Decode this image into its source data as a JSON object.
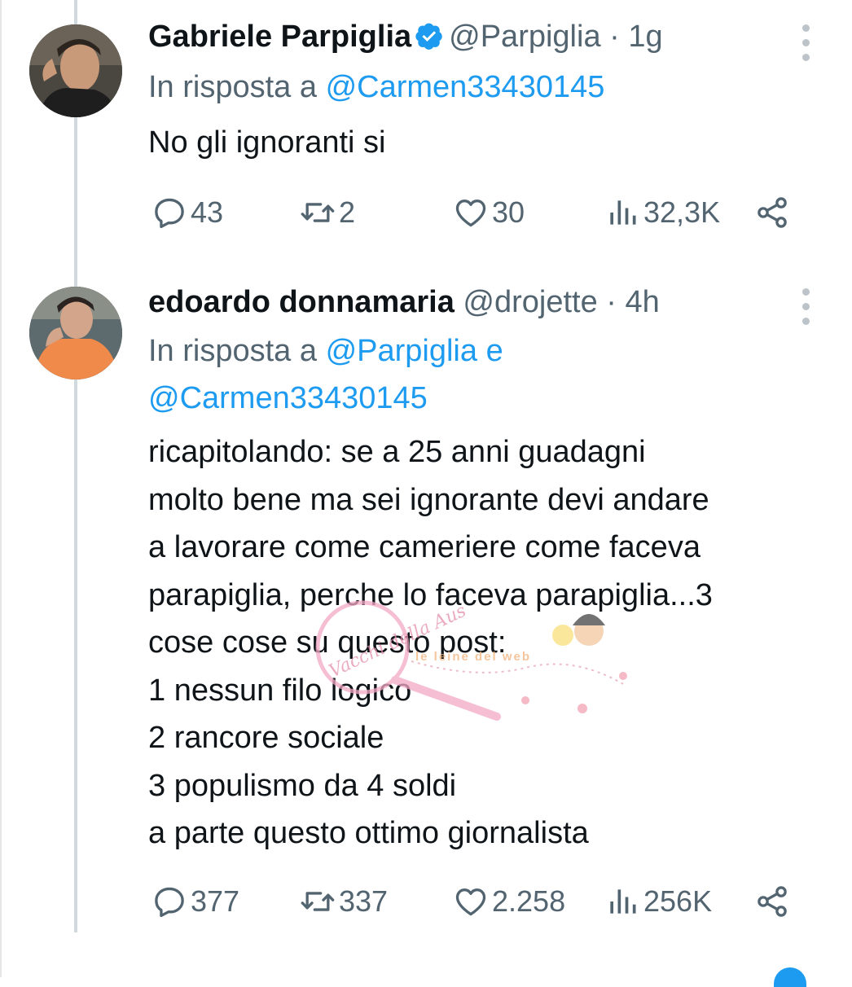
{
  "tweets": [
    {
      "name": "Gabriele Parpiglia",
      "verified": true,
      "handle": "@Parpiglia",
      "separator": "·",
      "time": "1g",
      "reply_prefix": "In risposta a",
      "reply_to_1": "@Carmen33430145",
      "reply_joiner": "",
      "reply_to_2": "",
      "text_lines": [
        "No gli ignoranti si"
      ],
      "replies": "43",
      "retweets": "2",
      "likes": "30",
      "views": "32,3K"
    },
    {
      "name": "edoardo donnamaria",
      "verified": false,
      "handle": "@drojette",
      "separator": "·",
      "time": "4h",
      "reply_prefix": "In risposta a",
      "reply_to_1": "@Parpiglia",
      "reply_joiner": "e",
      "reply_to_2": "@Carmen33430145",
      "text_lines": [
        "ricapitolando: se a 25 anni guadagni",
        "molto bene ma sei ignorante devi andare",
        "a lavorare come cameriere come faceva",
        "parapiglia, perche lo faceva parapiglia...3",
        "cose cose su questo post:",
        "1 nessun filo logico",
        "2 rancore sociale",
        "3 populismo da 4 soldi",
        "a parte questo ottimo giornalista"
      ],
      "replies": "377",
      "retweets": "337",
      "likes": "2.258",
      "views": "256K"
    }
  ],
  "watermark": {
    "brand": "Vacchi della Aus",
    "tagline": "le leine del web"
  },
  "colors": {
    "link": "#1d9bf0",
    "secondary_text": "#536471",
    "primary_text": "#0f1419",
    "thread_line": "#cfd9de"
  },
  "icons": [
    "reply-icon",
    "retweet-icon",
    "like-icon",
    "views-icon",
    "share-icon",
    "verified-badge-icon",
    "more-options-icon"
  ]
}
